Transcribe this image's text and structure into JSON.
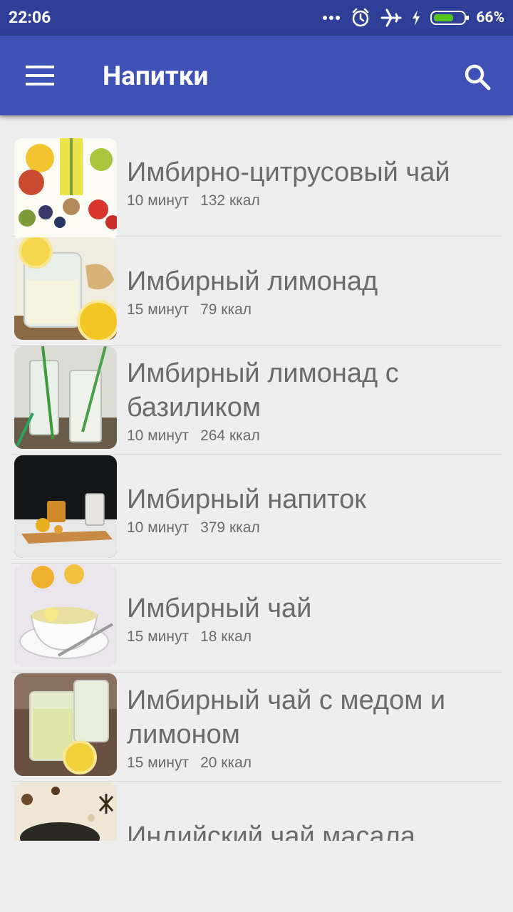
{
  "status_bar": {
    "time": "22:06",
    "battery_percent": "66%",
    "battery_level": 0.66,
    "icons": [
      "more-dots-icon",
      "alarm-icon",
      "airplane-mode-icon",
      "charging-bolt-icon",
      "battery-icon"
    ]
  },
  "app_bar": {
    "title": "Напитки",
    "menu_icon": "hamburger-menu-icon",
    "search_icon": "search-icon",
    "color": "#3f51b5"
  },
  "recipes": [
    {
      "name": "Имбирно-цитрусовый чай",
      "time": "10 минут",
      "calories": "132 ккал"
    },
    {
      "name": "Имбирный лимонад",
      "time": "15 минут",
      "calories": "79 ккал"
    },
    {
      "name": "Имбирный лимонад с базиликом",
      "time": "10 минут",
      "calories": "264 ккал"
    },
    {
      "name": "Имбирный напиток",
      "time": "10 минут",
      "calories": "379 ккал"
    },
    {
      "name": "Имбирный чай",
      "time": "15 минут",
      "calories": "18 ккал"
    },
    {
      "name": "Имбирный чай с медом и лимоном",
      "time": "15 минут",
      "calories": "20 ккал"
    },
    {
      "name": "Индийский чай масала",
      "time": "",
      "calories": ""
    }
  ]
}
